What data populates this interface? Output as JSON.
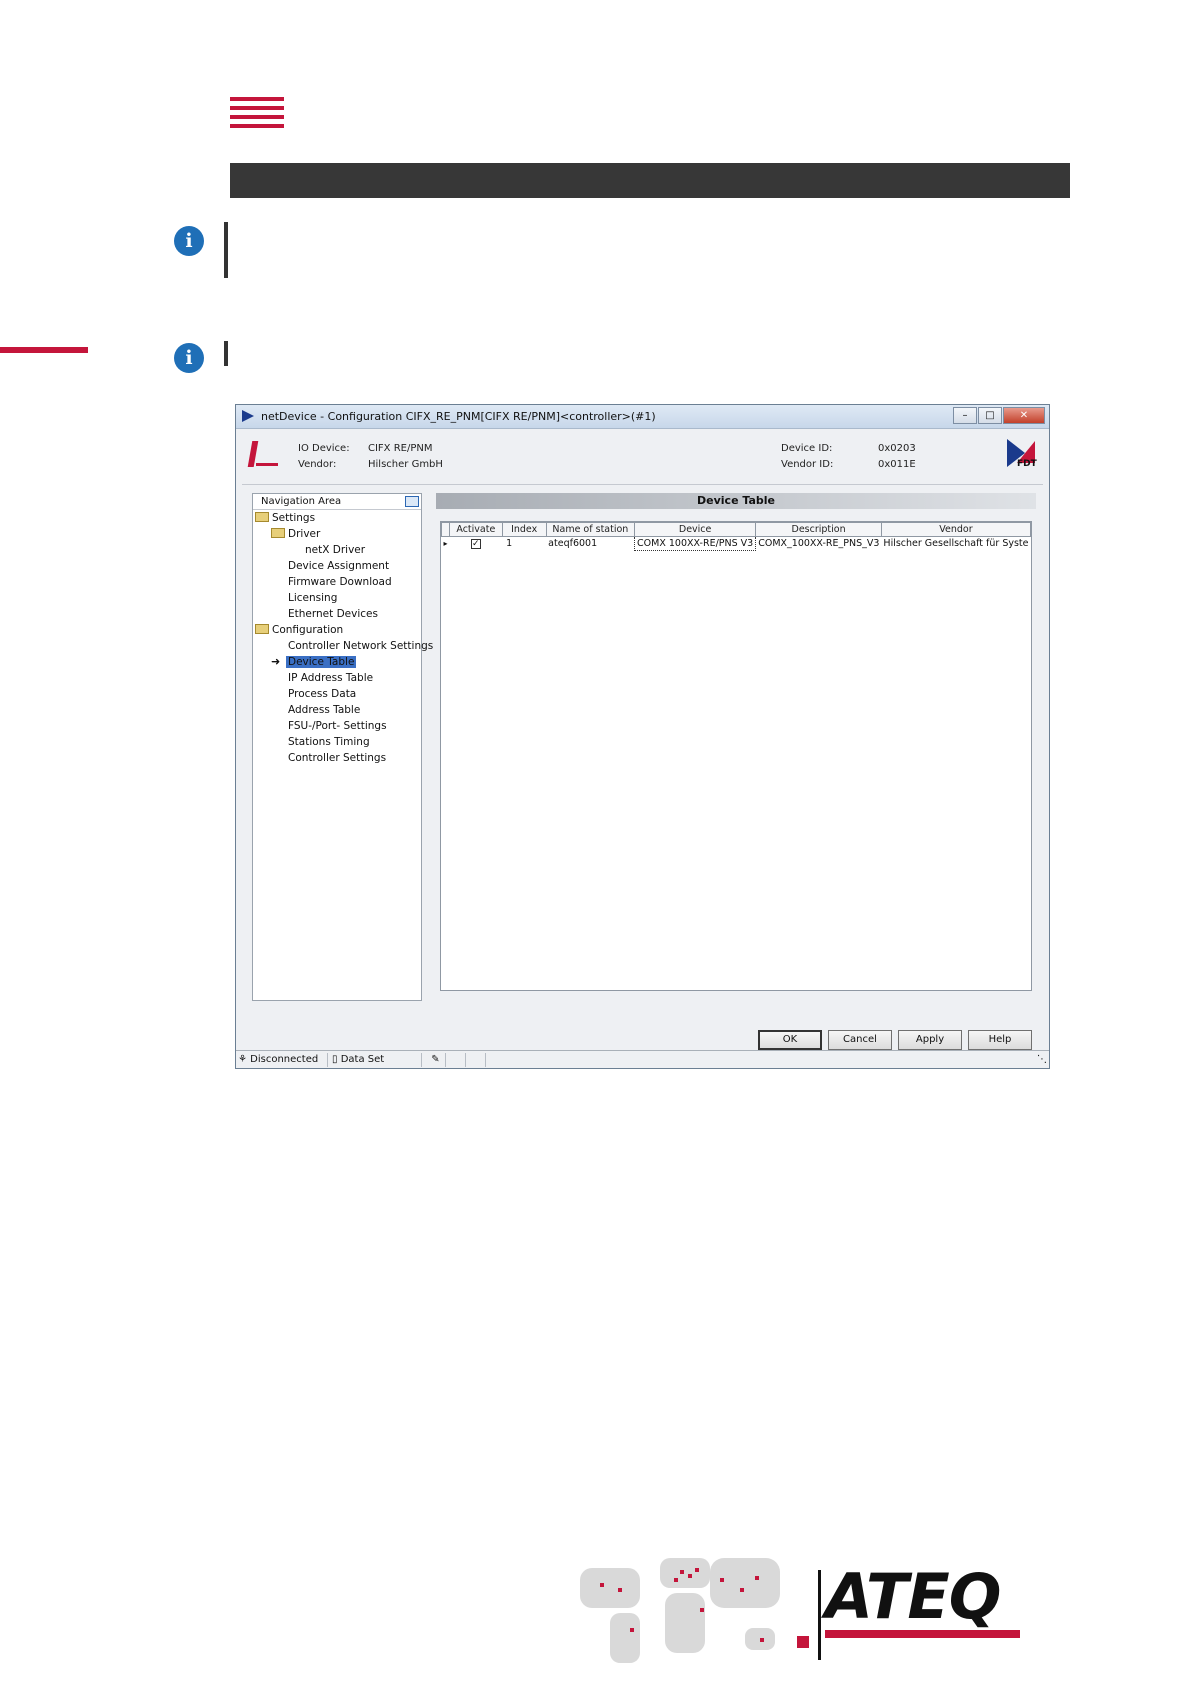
{
  "window": {
    "title": "netDevice - Configuration CIFX_RE_PNM[CIFX RE/PNM]<controller>(#1)",
    "header": {
      "io_device_label": "IO Device:",
      "io_device_value": "CIFX RE/PNM",
      "vendor_label": "Vendor:",
      "vendor_value": "Hilscher GmbH",
      "device_id_label": "Device ID:",
      "device_id_value": "0x0203",
      "vendor_id_label": "Vendor ID:",
      "vendor_id_value": "0x011E",
      "fdt_logo_text": "FDT"
    },
    "navigation": {
      "title": "Navigation Area",
      "items": [
        "Settings",
        "Driver",
        "netX Driver",
        "Device Assignment",
        "Firmware Download",
        "Licensing",
        "Ethernet Devices",
        "Configuration",
        "Controller Network Settings",
        "Device Table",
        "IP Address Table",
        "Process Data",
        "Address Table",
        "FSU-/Port- Settings",
        "Stations Timing",
        "Controller Settings"
      ],
      "selected": "Device Table"
    },
    "device_table": {
      "title": "Device Table",
      "columns": [
        "Activate",
        "Index",
        "Name of station",
        "Device",
        "Description",
        "Vendor"
      ],
      "rows": [
        {
          "activate": true,
          "index": "1",
          "name": "ateqf6001",
          "device": "COMX 100XX-RE/PNS V3",
          "description": "COMX_100XX-RE_PNS_V3",
          "vendor": "Hilscher Gesellschaft für Syste"
        }
      ]
    },
    "buttons": {
      "ok": "OK",
      "cancel": "Cancel",
      "apply": "Apply",
      "help": "Help"
    },
    "status_bar": {
      "connection": "Disconnected",
      "data_set": "Data Set"
    }
  },
  "footer": {
    "brand": "ATEQ"
  },
  "colors": {
    "accent": "#c4153b",
    "dark_bar": "#373737",
    "info_icon": "#1f6fb7",
    "selection": "#3a6fc4"
  }
}
